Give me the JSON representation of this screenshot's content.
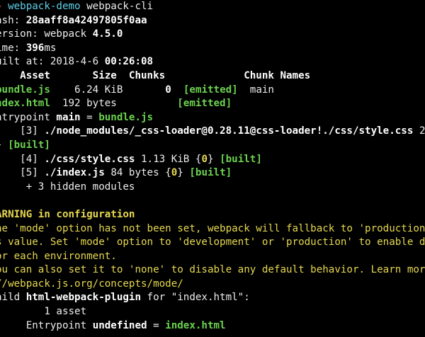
{
  "colors": {
    "background": "#000000",
    "text": "#ededed",
    "green": "#6bd14f",
    "yellow": "#e6d84f",
    "cyan": "#5fcfe8",
    "prompt": "#e94c3c"
  },
  "prompt": {
    "arrow": "❯",
    "directory": "webpack-demo",
    "command": "webpack-cli"
  },
  "build_info": {
    "hash_label": "ash: ",
    "hash": "28aaff8a42497805f0aa",
    "version_label": "ersion: webpack ",
    "version": "4.5.0",
    "time_label": "ime: ",
    "time": "396",
    "time_unit": "ms",
    "built_label": "uilt at: 2018-4-6 ",
    "built_time": "00:26:08"
  },
  "asset_table": {
    "header": "    Asset       Size  Chunks             Chunk Names",
    "rows": [
      {
        "asset": "bundle.js",
        "size": "6.24 KiB",
        "chunks": "0",
        "status": "[emitted]",
        "name": "main"
      },
      {
        "asset": "ndex.html",
        "size": "192 bytes",
        "chunks": "",
        "status": "[emitted]",
        "name": ""
      }
    ]
  },
  "entrypoint": {
    "label": "ntrypoint ",
    "name": "main",
    "eq": " = ",
    "file": "bundle.js"
  },
  "modules": [
    {
      "id": "[3]",
      "path": "./node_modules/_css-loader@0.28.11@css-loader!./css/style.css",
      "size": "225 by"
    },
    {
      "id": "[4]",
      "path": "./css/style.css",
      "size": "1.13 KiB",
      "chunk": "0",
      "status": "[built]"
    },
    {
      "id": "[5]",
      "path": "./index.js",
      "size": "84 bytes",
      "chunk": "0",
      "status": "[built]"
    }
  ],
  "module3_cont": {
    "brace_open": "} ",
    "status": "[built]"
  },
  "hidden_modules": "+ 3 hidden modules",
  "warning": {
    "title": "ARNING in configuration",
    "lines": [
      "he 'mode' option has not been set, webpack will fallback to 'production' fo",
      "s value. Set 'mode' option to 'development' or 'production' to enable defa",
      "or each environment.",
      "ou can also set it to 'none' to disable any default behavior. Learn more:",
      "//webpack.js.org/concepts/mode/"
    ]
  },
  "child": {
    "label": "hild ",
    "name": "html-webpack-plugin",
    "rest": " for \"index.html\":",
    "asset_count": "1 asset",
    "entry_label": "Entrypoint ",
    "entry_name": "undefined",
    "entry_eq": " = ",
    "entry_file": "index.html"
  }
}
